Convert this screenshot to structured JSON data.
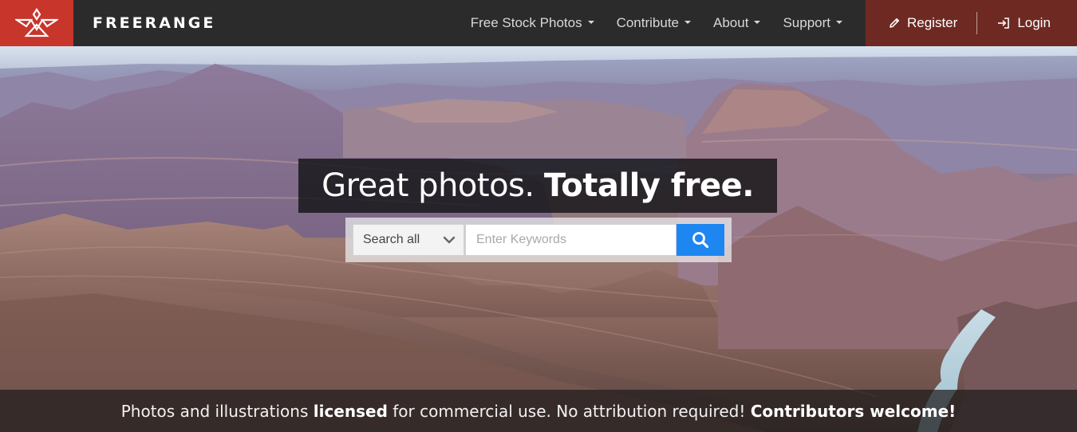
{
  "brand": {
    "name": "FREERANGE",
    "logo_icon": "freerange-bird-logo",
    "accent_color": "#c8352a"
  },
  "nav": {
    "items": [
      {
        "label": "Free Stock Photos",
        "has_dropdown": true
      },
      {
        "label": "Contribute",
        "has_dropdown": true
      },
      {
        "label": "About",
        "has_dropdown": true
      },
      {
        "label": "Support",
        "has_dropdown": true
      }
    ],
    "register": {
      "label": "Register",
      "icon": "pencil-icon"
    },
    "login": {
      "label": "Login",
      "icon": "login-arrow-icon"
    }
  },
  "hero": {
    "headline_regular": "Great photos.",
    "headline_bold": "Totally free."
  },
  "search": {
    "category_selected": "Search all",
    "placeholder": "Enter Keywords",
    "value": "",
    "button_icon": "search-icon",
    "button_color": "#1e86f0"
  },
  "tagline": {
    "part1": "Photos and illustrations ",
    "bold1": "licensed",
    "part2": " for commercial use. No attribution required! ",
    "bold2": "Contributors welcome!"
  }
}
